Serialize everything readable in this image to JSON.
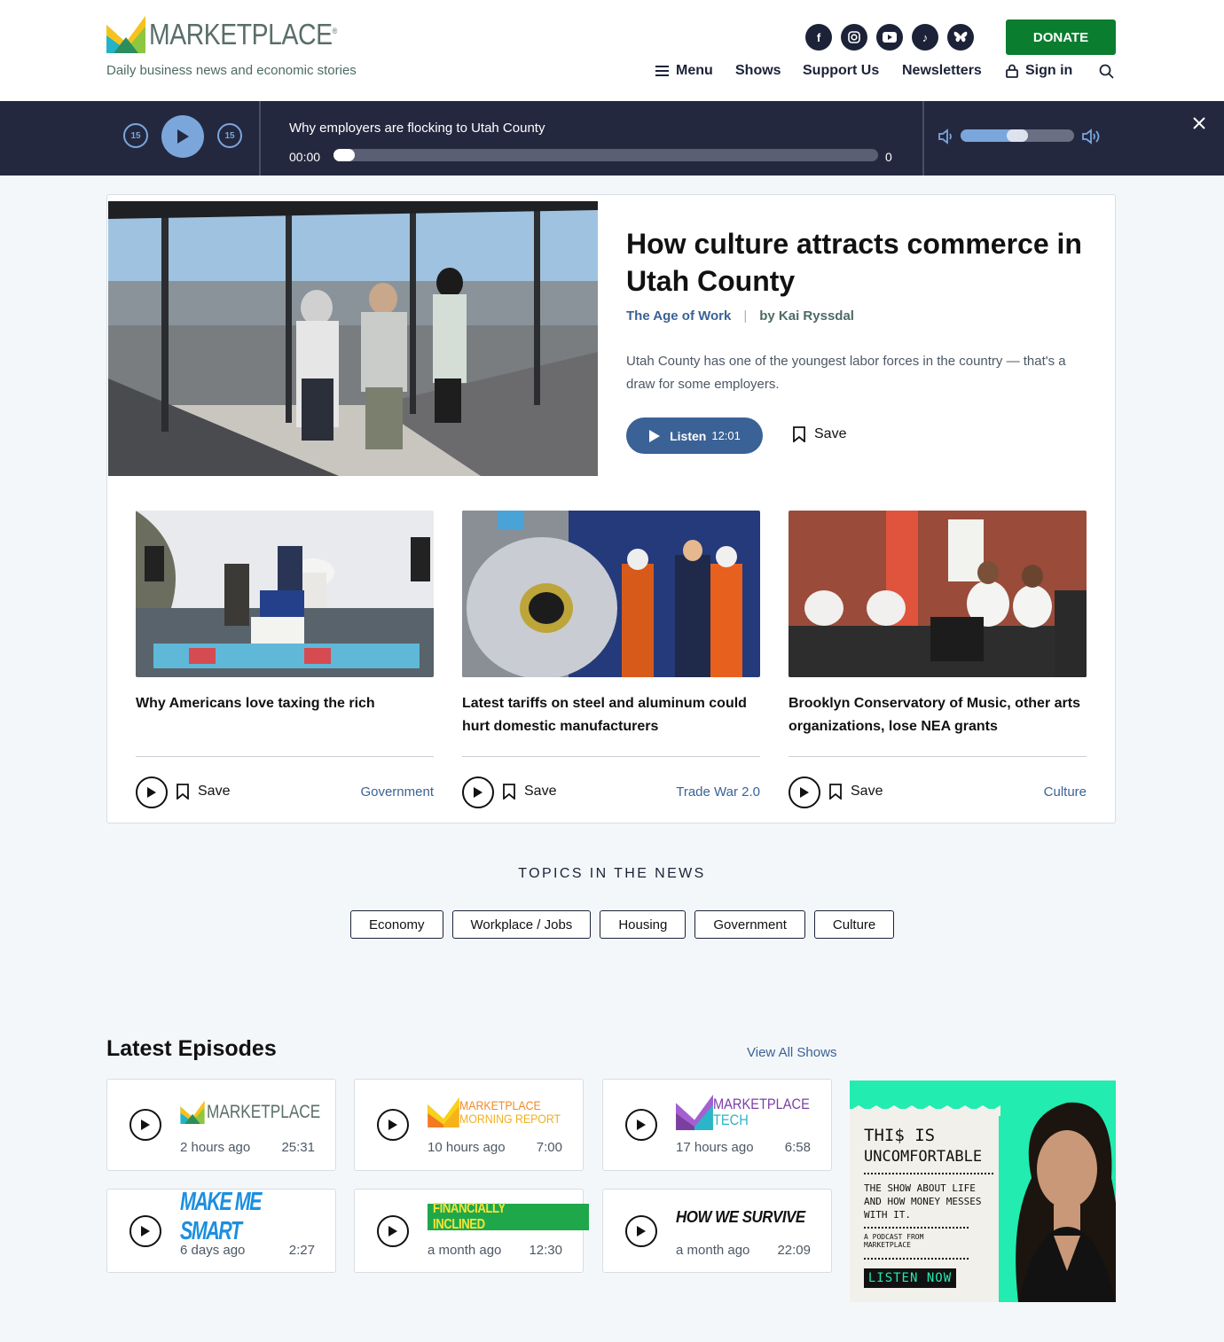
{
  "header": {
    "logo_text": "MARKETPLACE",
    "tagline": "Daily business news and economic stories",
    "social": [
      "facebook-icon",
      "instagram-icon",
      "youtube-icon",
      "tiktok-icon",
      "bluesky-icon"
    ],
    "donate": "DONATE",
    "nav": {
      "menu": "Menu",
      "shows": "Shows",
      "support": "Support Us",
      "newsletters": "Newsletters",
      "signin": "Sign in"
    }
  },
  "player": {
    "title": "Why employers are flocking to Utah County",
    "current_time": "00:00",
    "end_time": "0",
    "skip_back": "15",
    "skip_forward": "15",
    "progress": 0,
    "volume": 0.5
  },
  "feature": {
    "title": "How culture attracts commerce in Utah County",
    "topic": "The Age of Work",
    "byline": "by Kai Ryssdal",
    "description": "Utah County has one of the youngest labor forces in the country — that's a draw for some employers.",
    "listen_label": "Listen",
    "listen_duration": "12:01",
    "save_label": "Save"
  },
  "stories": [
    {
      "title": "Why Americans love taxing the rich",
      "tag": "Government",
      "save": "Save"
    },
    {
      "title": "Latest tariffs on steel and aluminum could hurt domestic manufacturers",
      "tag": "Trade War 2.0",
      "save": "Save"
    },
    {
      "title": "Brooklyn Conservatory of Music, other arts organizations, lose NEA grants",
      "tag": "Culture",
      "save": "Save"
    }
  ],
  "topics": {
    "heading": "TOPICS IN THE NEWS",
    "items": [
      "Economy",
      "Workplace / Jobs",
      "Housing",
      "Government",
      "Culture"
    ]
  },
  "episodes": {
    "heading": "Latest Episodes",
    "view_all": "View All Shows",
    "items": [
      {
        "show": "MARKETPLACE",
        "ago": "2 hours ago",
        "duration": "25:31"
      },
      {
        "show": "MARKETPLACE MORNING REPORT",
        "line1": "MARKETPLACE",
        "line2": "MORNING REPORT",
        "ago": "10 hours ago",
        "duration": "7:00"
      },
      {
        "show": "MARKETPLACE TECH",
        "line1": "MARKETPLACE",
        "line2": "TECH",
        "ago": "17 hours ago",
        "duration": "6:58"
      },
      {
        "show": "MAKE ME SMART",
        "ago": "6 days ago",
        "duration": "2:27"
      },
      {
        "show": "FINANCIALLY INCLINED",
        "ago": "a month ago",
        "duration": "12:30"
      },
      {
        "show": "HOW WE SURVIVE",
        "ago": "a month ago",
        "duration": "22:09"
      }
    ]
  },
  "ad": {
    "title_line1": "THI$ IS",
    "title_line2": "UNCOMFORTABLE",
    "subtitle": "THE SHOW ABOUT LIFE AND HOW MONEY MESSES WITH IT.",
    "from": "A PODCAST FROM MARKETPLACE",
    "cta": "LISTEN NOW"
  },
  "colors": {
    "navy": "#24283f",
    "accent_blue": "#3b6296",
    "donate_green": "#0b7d2f",
    "ad_green": "#22ecb0"
  }
}
